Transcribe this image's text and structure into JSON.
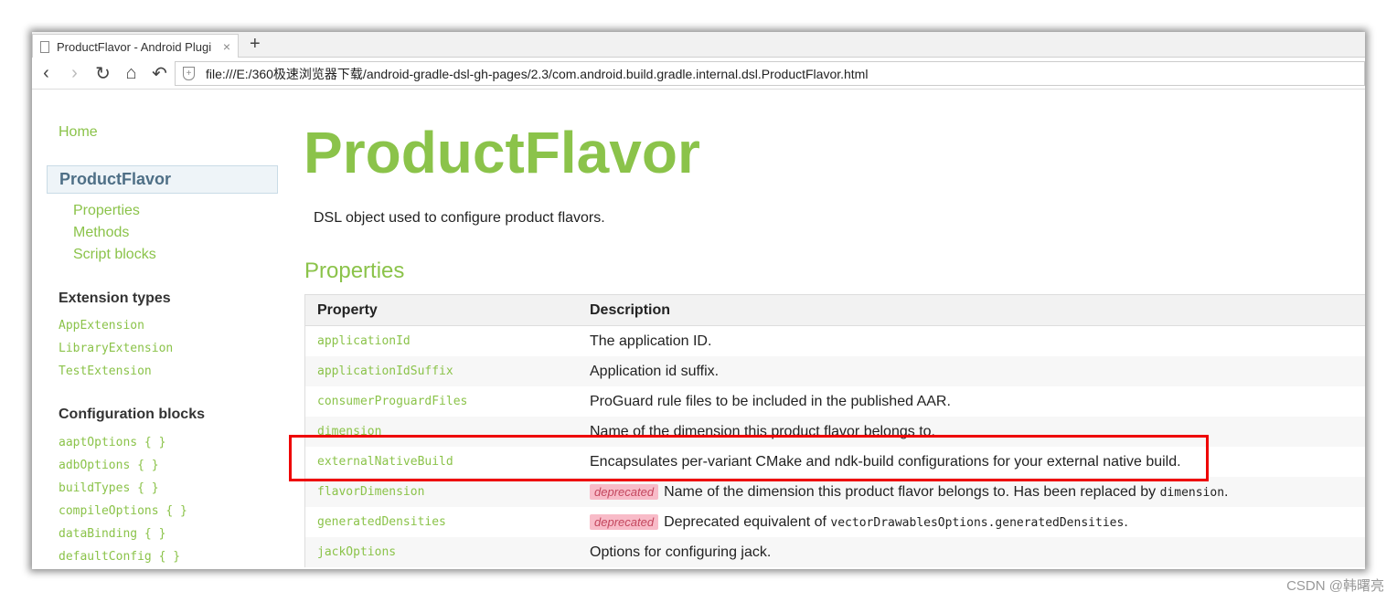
{
  "browser": {
    "tab_title": "ProductFlavor - Android Plugi",
    "new_tab": "+",
    "close": "×",
    "url": "file:///E:/360极速浏览器下载/android-gradle-dsl-gh-pages/2.3/com.android.build.gradle.internal.dsl.ProductFlavor.html",
    "nav_icons": [
      "back-icon",
      "forward-icon",
      "reload-icon",
      "home-icon",
      "undo-icon"
    ]
  },
  "sidebar": {
    "home": "Home",
    "current": "ProductFlavor",
    "sub": [
      "Properties",
      "Methods",
      "Script blocks"
    ],
    "ext_heading": "Extension types",
    "ext": [
      "AppExtension",
      "LibraryExtension",
      "TestExtension"
    ],
    "cfg_heading": "Configuration blocks",
    "cfg": [
      "aaptOptions { }",
      "adbOptions { }",
      "buildTypes { }",
      "compileOptions { }",
      "dataBinding { }",
      "defaultConfig { }"
    ]
  },
  "main": {
    "title": "ProductFlavor",
    "desc": "DSL object used to configure product flavors.",
    "section": "Properties",
    "headers": [
      "Property",
      "Description"
    ],
    "rows": [
      {
        "p": "applicationId",
        "d": "The application ID."
      },
      {
        "p": "applicationIdSuffix",
        "d": "Application id suffix."
      },
      {
        "p": "consumerProguardFiles",
        "d": "ProGuard rule files to be included in the published AAR."
      },
      {
        "p": "dimension",
        "d": "Name of the dimension this product flavor belongs to."
      },
      {
        "p": "externalNativeBuild",
        "d": "Encapsulates per-variant CMake and ndk-build configurations for your external native build."
      },
      {
        "p": "flavorDimension",
        "badge": "deprecated",
        "d": "Name of the dimension this product flavor belongs to. Has been replaced by ",
        "code": "dimension",
        "end": "."
      },
      {
        "p": "generatedDensities",
        "badge": "deprecated",
        "d": "Deprecated equivalent of ",
        "code": "vectorDrawablesOptions.generatedDensities",
        "end": "."
      },
      {
        "p": "jackOptions",
        "d": "Options for configuring jack."
      }
    ]
  },
  "colors": {
    "accent": "#8bc34a",
    "highlight": "#e00000",
    "badge": "#f8bbc8"
  },
  "watermark": "CSDN @韩曙亮"
}
